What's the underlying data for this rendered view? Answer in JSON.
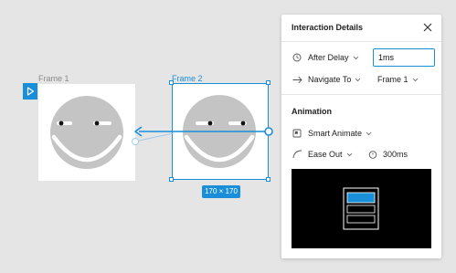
{
  "canvas": {
    "frames": [
      {
        "label": "Frame 1"
      },
      {
        "label": "Frame 2"
      }
    ],
    "selection_size": "170 × 170"
  },
  "panel": {
    "title": "Interaction Details",
    "trigger": {
      "label": "After Delay",
      "delay_value": "1ms"
    },
    "action": {
      "label": "Navigate To",
      "destination": "Frame 1"
    },
    "animation": {
      "section_title": "Animation",
      "type": "Smart Animate",
      "easing": "Ease Out",
      "duration": "300ms"
    }
  },
  "colors": {
    "accent": "#1a8fd9",
    "canvas_bg": "#e5e5e5",
    "face": "#c4c4c4",
    "preview_bg": "#000000"
  },
  "icons": [
    "play-icon",
    "clock-icon",
    "arrow-right-icon",
    "smart-animate-icon",
    "ease-curve-icon",
    "timer-icon",
    "close-icon",
    "chevron-down-icon"
  ]
}
